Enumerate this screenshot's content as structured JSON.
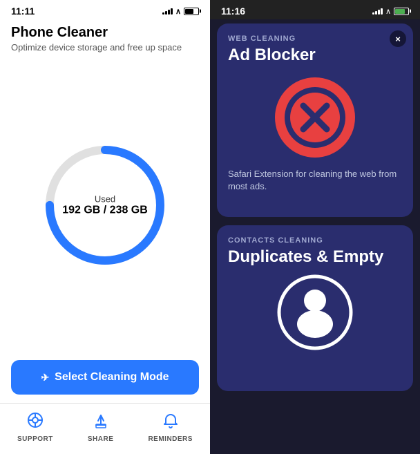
{
  "left": {
    "status_bar": {
      "time": "11:11",
      "signal_alt": "signal",
      "wifi_alt": "wifi",
      "battery_alt": "battery"
    },
    "header": {
      "title": "Phone Cleaner",
      "subtitle": "Optimize device storage and free up space"
    },
    "storage": {
      "label": "Used",
      "value": "192 GB / 238 GB",
      "used_gb": 192,
      "total_gb": 238
    },
    "select_btn": {
      "label": "Select Cleaning Mode",
      "icon": "✈"
    },
    "nav": [
      {
        "label": "SUPPORT",
        "icon": "🛟"
      },
      {
        "label": "SHARE",
        "icon": "⬆"
      },
      {
        "label": "REMINDERS",
        "icon": "🔔"
      }
    ]
  },
  "right": {
    "status_bar": {
      "time": "11:16"
    },
    "web_card": {
      "category": "WEB CLEANING",
      "title": "Ad Blocker",
      "description": "Safari Extension for cleaning the web from most ads.",
      "close_label": "×"
    },
    "contacts_card": {
      "category": "CONTACTS CLEANING",
      "title": "Duplicates & Empty"
    }
  }
}
